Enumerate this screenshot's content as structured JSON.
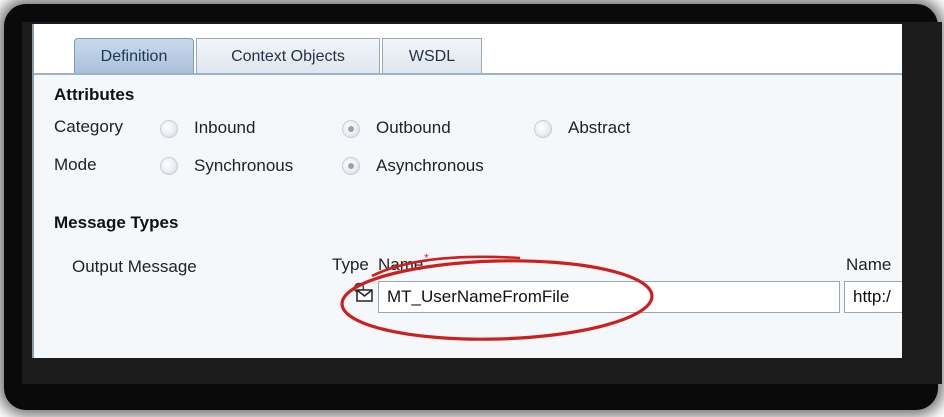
{
  "tabs": [
    {
      "label": "Definition",
      "active": true
    },
    {
      "label": "Context Objects",
      "active": false
    },
    {
      "label": "WSDL",
      "active": false
    }
  ],
  "attributes": {
    "title": "Attributes",
    "category": {
      "label": "Category",
      "options": [
        {
          "label": "Inbound",
          "checked": false
        },
        {
          "label": "Outbound",
          "checked": true
        },
        {
          "label": "Abstract",
          "checked": false
        }
      ]
    },
    "mode": {
      "label": "Mode",
      "options": [
        {
          "label": "Synchronous",
          "checked": false
        },
        {
          "label": "Asynchronous",
          "checked": true
        }
      ]
    }
  },
  "message_types": {
    "title": "Message Types",
    "row_label": "Output Message",
    "col_type": "Type",
    "col_name": "Name",
    "col_name_required": "*",
    "col_namespace": "Name",
    "name_value": "MT_UserNameFromFile",
    "namespace_value": "http:/",
    "type_icon": "message-type-icon"
  },
  "colors": {
    "tab_active": "#a9c2dc",
    "annotation": "#cc1f1f",
    "frame": "#0a0a0a"
  }
}
